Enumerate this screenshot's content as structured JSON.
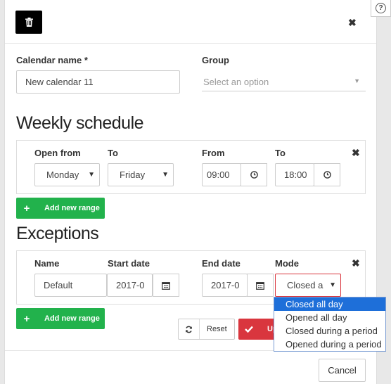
{
  "header": {
    "delete_icon": "trash-icon",
    "close_symbol": "✖",
    "help_symbol": "?"
  },
  "form": {
    "calendar_name_label": "Calendar name *",
    "calendar_name_value": "New calendar 11",
    "group_label": "Group",
    "group_placeholder": "Select an option"
  },
  "weekly": {
    "title": "Weekly schedule",
    "col_open_from": "Open from",
    "col_to": "To",
    "col_from": "From",
    "col_to2": "To",
    "open_from_value": "Monday",
    "to_value": "Friday",
    "from_time": "09:00",
    "to_time": "18:00",
    "remove_symbol": "✖",
    "add_range_label": "Add new range"
  },
  "exceptions": {
    "title": "Exceptions",
    "col_name": "Name",
    "col_start_date": "Start date",
    "col_end_date": "End date",
    "col_mode": "Mode",
    "name_value": "Default",
    "start_date_value": "2017-0",
    "end_date_value": "2017-0",
    "mode_value": "Closed a",
    "remove_symbol": "✖",
    "add_range_label": "Add new range",
    "mode_options": [
      "Closed all day",
      "Opened all day",
      "Closed during a period",
      "Opened during a period"
    ]
  },
  "actions": {
    "reset_label": "Reset",
    "update_label": "Up",
    "cancel_label": "Cancel"
  },
  "colors": {
    "green": "#22b24c",
    "red": "#d9363e",
    "highlight": "#1e6fd9"
  }
}
